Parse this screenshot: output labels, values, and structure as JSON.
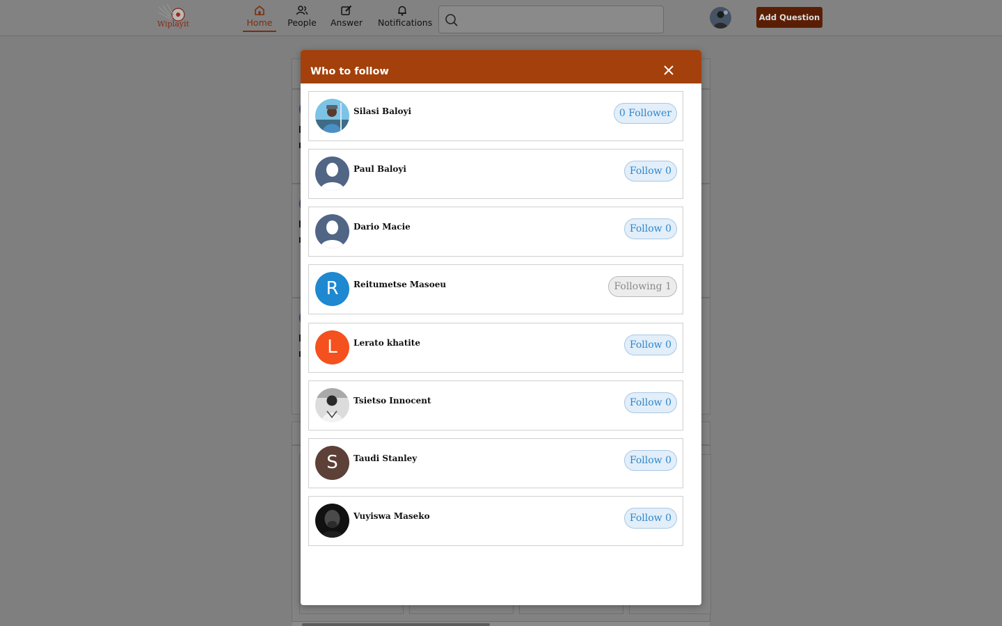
{
  "nav": {
    "logo_text": "Wiplayit",
    "items": [
      {
        "label": "Home",
        "icon": "home-icon"
      },
      {
        "label": "People",
        "icon": "people-icon"
      },
      {
        "label": "Answer",
        "icon": "edit-icon"
      },
      {
        "label": "Notifications",
        "icon": "bell-icon"
      }
    ],
    "search_placeholder": "",
    "add_question_label": "Add Question"
  },
  "modal": {
    "title": "Who to follow",
    "users": [
      {
        "name": "Silasi Baloyi",
        "button": "0 Follower",
        "state": "self",
        "avatar": "photo",
        "initial": ""
      },
      {
        "name": "Paul Baloyi",
        "button": "Follow 0",
        "state": "follow",
        "avatar": "default-silhouette",
        "initial": ""
      },
      {
        "name": "Dario Macie",
        "button": "Follow 0",
        "state": "follow",
        "avatar": "default-silhouette",
        "initial": ""
      },
      {
        "name": "Reitumetse Masoeu",
        "button": "Following 1",
        "state": "following",
        "avatar": "letter",
        "initial": "R",
        "color": "#1e88d0"
      },
      {
        "name": "Lerato khatite",
        "button": "Follow 0",
        "state": "follow",
        "avatar": "letter",
        "initial": "L",
        "color": "#f4511e"
      },
      {
        "name": "Tsietso Innocent",
        "button": "Follow 0",
        "state": "follow",
        "avatar": "photo",
        "initial": ""
      },
      {
        "name": "Taudi Stanley",
        "button": "Follow 0",
        "state": "follow",
        "avatar": "letter",
        "initial": "S",
        "color": "#5d4037"
      },
      {
        "name": "Vuyiswa Maseko",
        "button": "Follow 0",
        "state": "follow",
        "avatar": "photo",
        "initial": ""
      }
    ]
  },
  "colors": {
    "brand": "#a3400c",
    "add_button": "#5a1e05",
    "follow_text": "#2f86cc",
    "follow_bg": "#e2eef9"
  }
}
